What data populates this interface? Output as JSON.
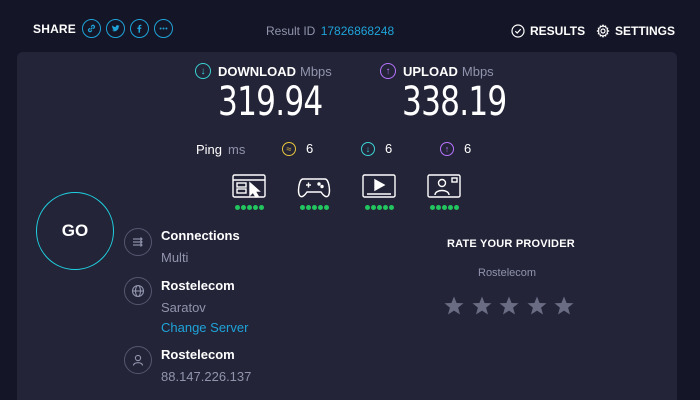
{
  "header": {
    "share_label": "SHARE",
    "share_buttons": [
      "link-icon",
      "twitter-icon",
      "facebook-icon",
      "more-icon"
    ],
    "result_label": "Result ID",
    "result_id": "17826868248",
    "results_label": "RESULTS",
    "settings_label": "SETTINGS"
  },
  "speeds": {
    "download_label": "DOWNLOAD",
    "download_unit": "Mbps",
    "download_value": "319.94",
    "upload_label": "UPLOAD",
    "upload_unit": "Mbps",
    "upload_value": "338.19"
  },
  "ping": {
    "label": "Ping",
    "unit": "ms",
    "jitter": "6",
    "download": "6",
    "upload": "6"
  },
  "services": [
    "browsing-icon",
    "gaming-icon",
    "streaming-icon",
    "video-call-icon"
  ],
  "go_label": "GO",
  "connections": {
    "title": "Connections",
    "value": "Multi"
  },
  "server": {
    "name": "Rostelecom",
    "location": "Saratov",
    "change_label": "Change Server"
  },
  "client": {
    "isp": "Rostelecom",
    "ip": "88.147.226.137"
  },
  "rating": {
    "title": "RATE YOUR PROVIDER",
    "provider": "Rostelecom",
    "stars": 5
  },
  "colors": {
    "background": "#141526",
    "panel": "#232438",
    "accent": "#1fa3d8",
    "download": "#3bd3d3",
    "upload": "#b874ff",
    "jitter": "#e8c53c",
    "good": "#22c55e"
  }
}
